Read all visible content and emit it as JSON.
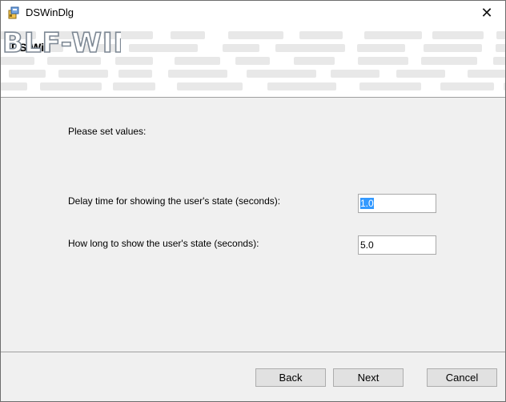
{
  "window": {
    "title": "DSWinDlg",
    "close_glyph": "✕"
  },
  "banner": {
    "title": "DS-Win",
    "logo_text": "BLF-WIN"
  },
  "content": {
    "intro": "Please set values:",
    "rows": [
      {
        "label": "Delay time for showing the user's state (seconds):",
        "value": "1.0",
        "selected": true
      },
      {
        "label": "How long to show the user's state (seconds):",
        "value": "5.0",
        "selected": false
      }
    ]
  },
  "buttons": {
    "back": "Back",
    "next": "Next",
    "cancel": "Cancel"
  },
  "icons": {
    "app": "installer-app-icon",
    "close": "close-icon"
  },
  "colors": {
    "selection": "#3399ff",
    "logo": "#c9cfd6",
    "banner_pattern": "#e6e6e6"
  }
}
